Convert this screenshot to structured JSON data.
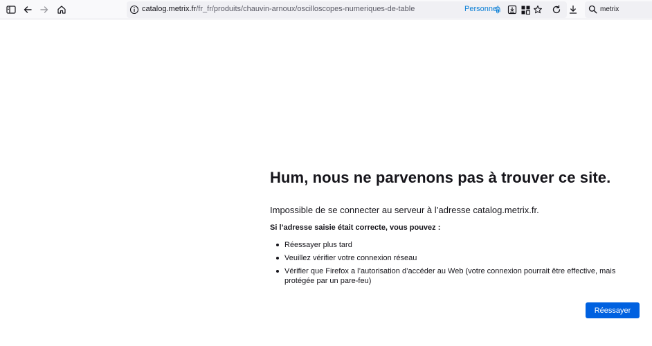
{
  "browser": {
    "url": {
      "domain": "catalog.metrix.fr",
      "path": "/fr_fr/produits/chauvin-arnoux/oscilloscopes-numeriques-de-table"
    },
    "container_label": "Personnel",
    "search_value": "metrix",
    "icons": [
      "sidebar-icon",
      "back-icon",
      "forward-icon",
      "home-icon",
      "info-icon",
      "fingerprint-icon",
      "save-to-device-icon",
      "extensions-icon",
      "bookmark-star-icon",
      "reload-icon",
      "download-icon",
      "search-icon"
    ]
  },
  "error": {
    "title": "Hum, nous ne parvenons pas à trouver ce site.",
    "description": "Impossible de se connecter au serveur à l’adresse catalog.metrix.fr.",
    "subtitle": "Si l’adresse saisie était correcte, vous pouvez :",
    "suggestions": [
      "Réessayer plus tard",
      "Veuillez vérifier votre connexion réseau",
      "Vérifier que Firefox a l’autorisation d’accéder au Web (votre connexion pourrait être effective, mais protégée par un pare-feu)"
    ],
    "retry_label": "Réessayer"
  },
  "colors": {
    "accent": "#0061e0",
    "container": "#0b7fd6",
    "toolbar_bg": "#f9f9fb",
    "urlbar_bg": "#f0f0f4"
  }
}
